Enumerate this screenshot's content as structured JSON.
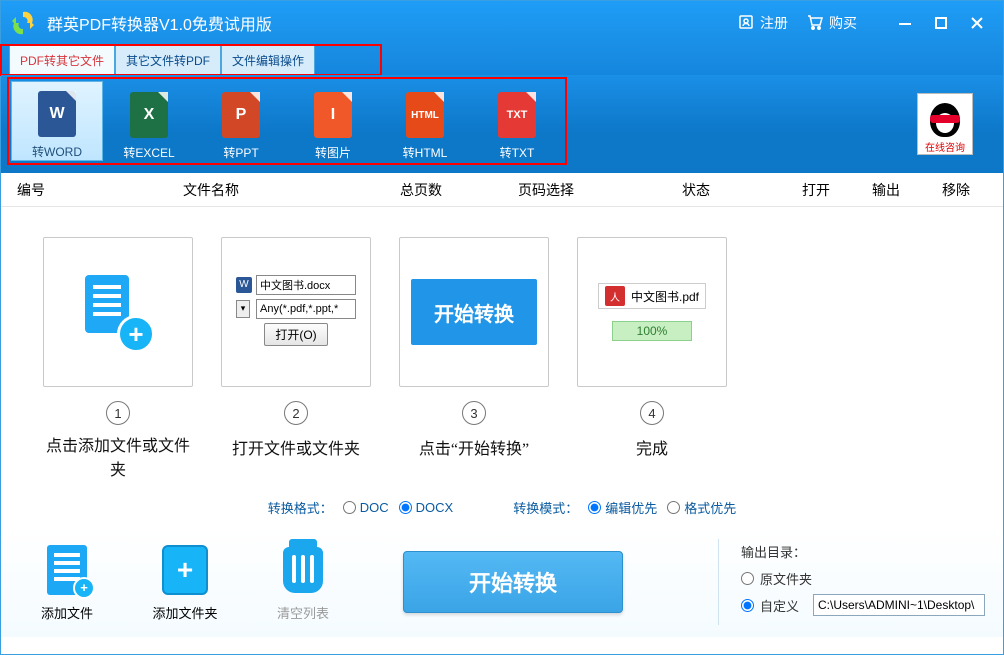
{
  "titlebar": {
    "title": "群英PDF转换器V1.0免费试用版",
    "register": "注册",
    "buy": "购买"
  },
  "tabs": {
    "t1": "PDF转其它文件",
    "t2": "其它文件转PDF",
    "t3": "文件编辑操作"
  },
  "convert": {
    "word": "转WORD",
    "excel": "转EXCEL",
    "ppt": "转PPT",
    "img": "转图片",
    "html": "转HTML",
    "txt": "转TXT"
  },
  "qq": {
    "label": "在线咨询"
  },
  "columns": {
    "id": "编号",
    "name": "文件名称",
    "pages": "总页数",
    "range": "页码选择",
    "status": "状态",
    "open": "打开",
    "output": "输出",
    "remove": "移除"
  },
  "steps": {
    "s1": "点击添加文件或文件夹",
    "s2": "打开文件或文件夹",
    "s3": "点击“开始转换”",
    "s4": "完成",
    "n1": "1",
    "n2": "2",
    "n3": "3",
    "n4": "4",
    "dlg_file": "中文图书.docx",
    "dlg_filter": "Any(*.pdf,*.ppt,*",
    "dlg_open": "打开(O)",
    "start_label": "开始转换",
    "done_file": "中文图书.pdf",
    "done_progress": "100%"
  },
  "format": {
    "label1": "转换格式：",
    "opt_doc": "DOC",
    "opt_docx": "DOCX",
    "label2": "转换模式：",
    "opt_edit": "编辑优先",
    "opt_layout": "格式优先"
  },
  "bottom": {
    "add_file": "添加文件",
    "add_folder": "添加文件夹",
    "clear": "清空列表",
    "start": "开始转换",
    "outdir_label": "输出目录：",
    "opt_same": "原文件夹",
    "opt_custom": "自定义",
    "path": "C:\\Users\\ADMINI~1\\Desktop\\"
  }
}
